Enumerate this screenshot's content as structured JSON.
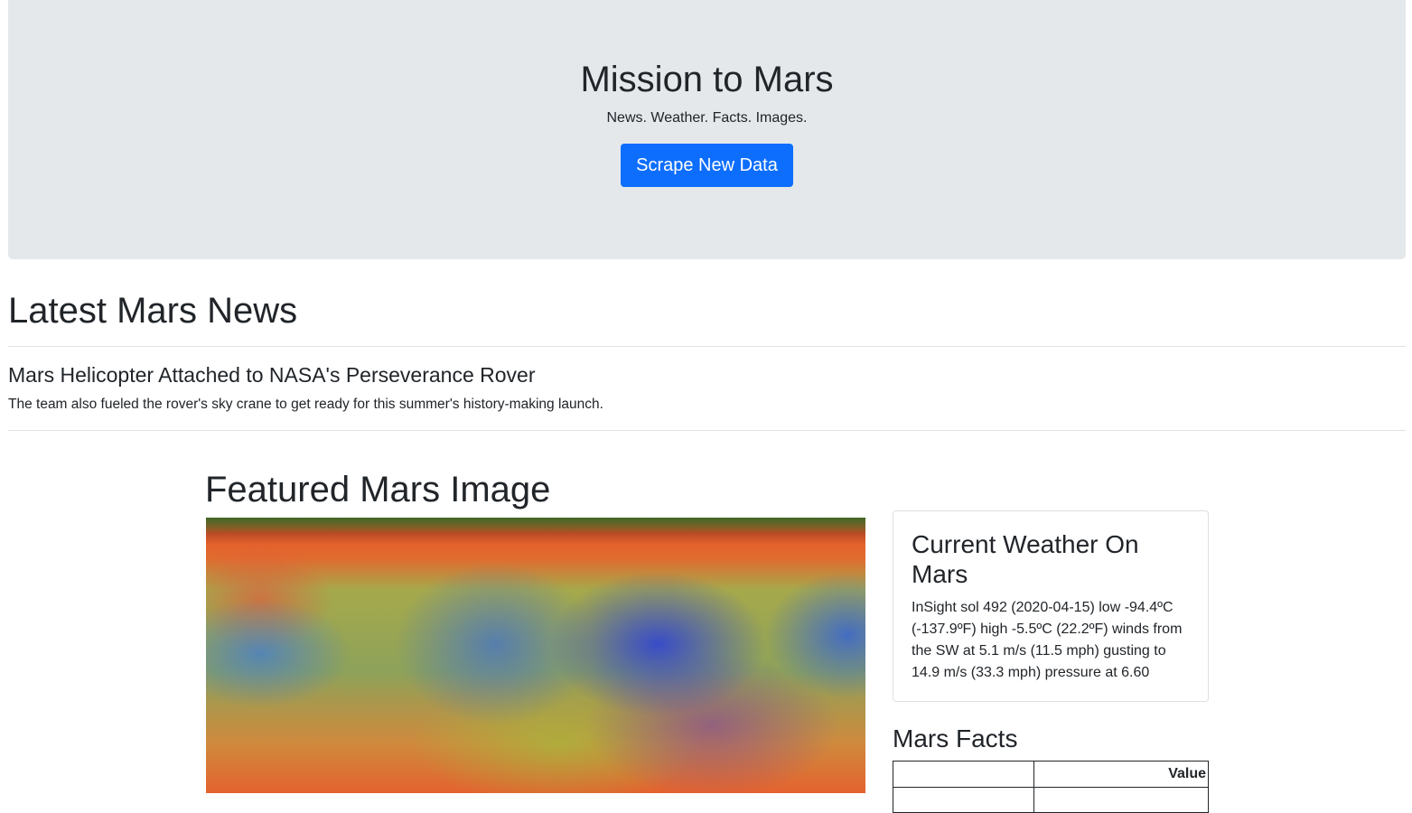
{
  "header": {
    "title": "Mission to Mars",
    "tagline": "News. Weather. Facts. Images.",
    "scrape_button": "Scrape New Data"
  },
  "news": {
    "heading": "Latest Mars News",
    "title": "Mars Helicopter Attached to NASA's Perseverance Rover",
    "teaser": "The team also fueled the rover's sky crane to get ready for this summer's history-making launch."
  },
  "featured": {
    "heading": "Featured Mars Image"
  },
  "weather": {
    "heading": "Current Weather On Mars",
    "report": "InSight sol 492 (2020-04-15) low -94.4ºC (-137.9ºF) high -5.5ºC (22.2ºF) winds from the SW at 5.1 m/s (11.5 mph) gusting to 14.9 m/s (33.3 mph) pressure at 6.60"
  },
  "facts": {
    "heading": "Mars Facts",
    "columns": [
      "",
      "Value"
    ]
  },
  "colors": {
    "accent": "#0d6efd",
    "jumbotron_bg": "#e4e8eb"
  }
}
